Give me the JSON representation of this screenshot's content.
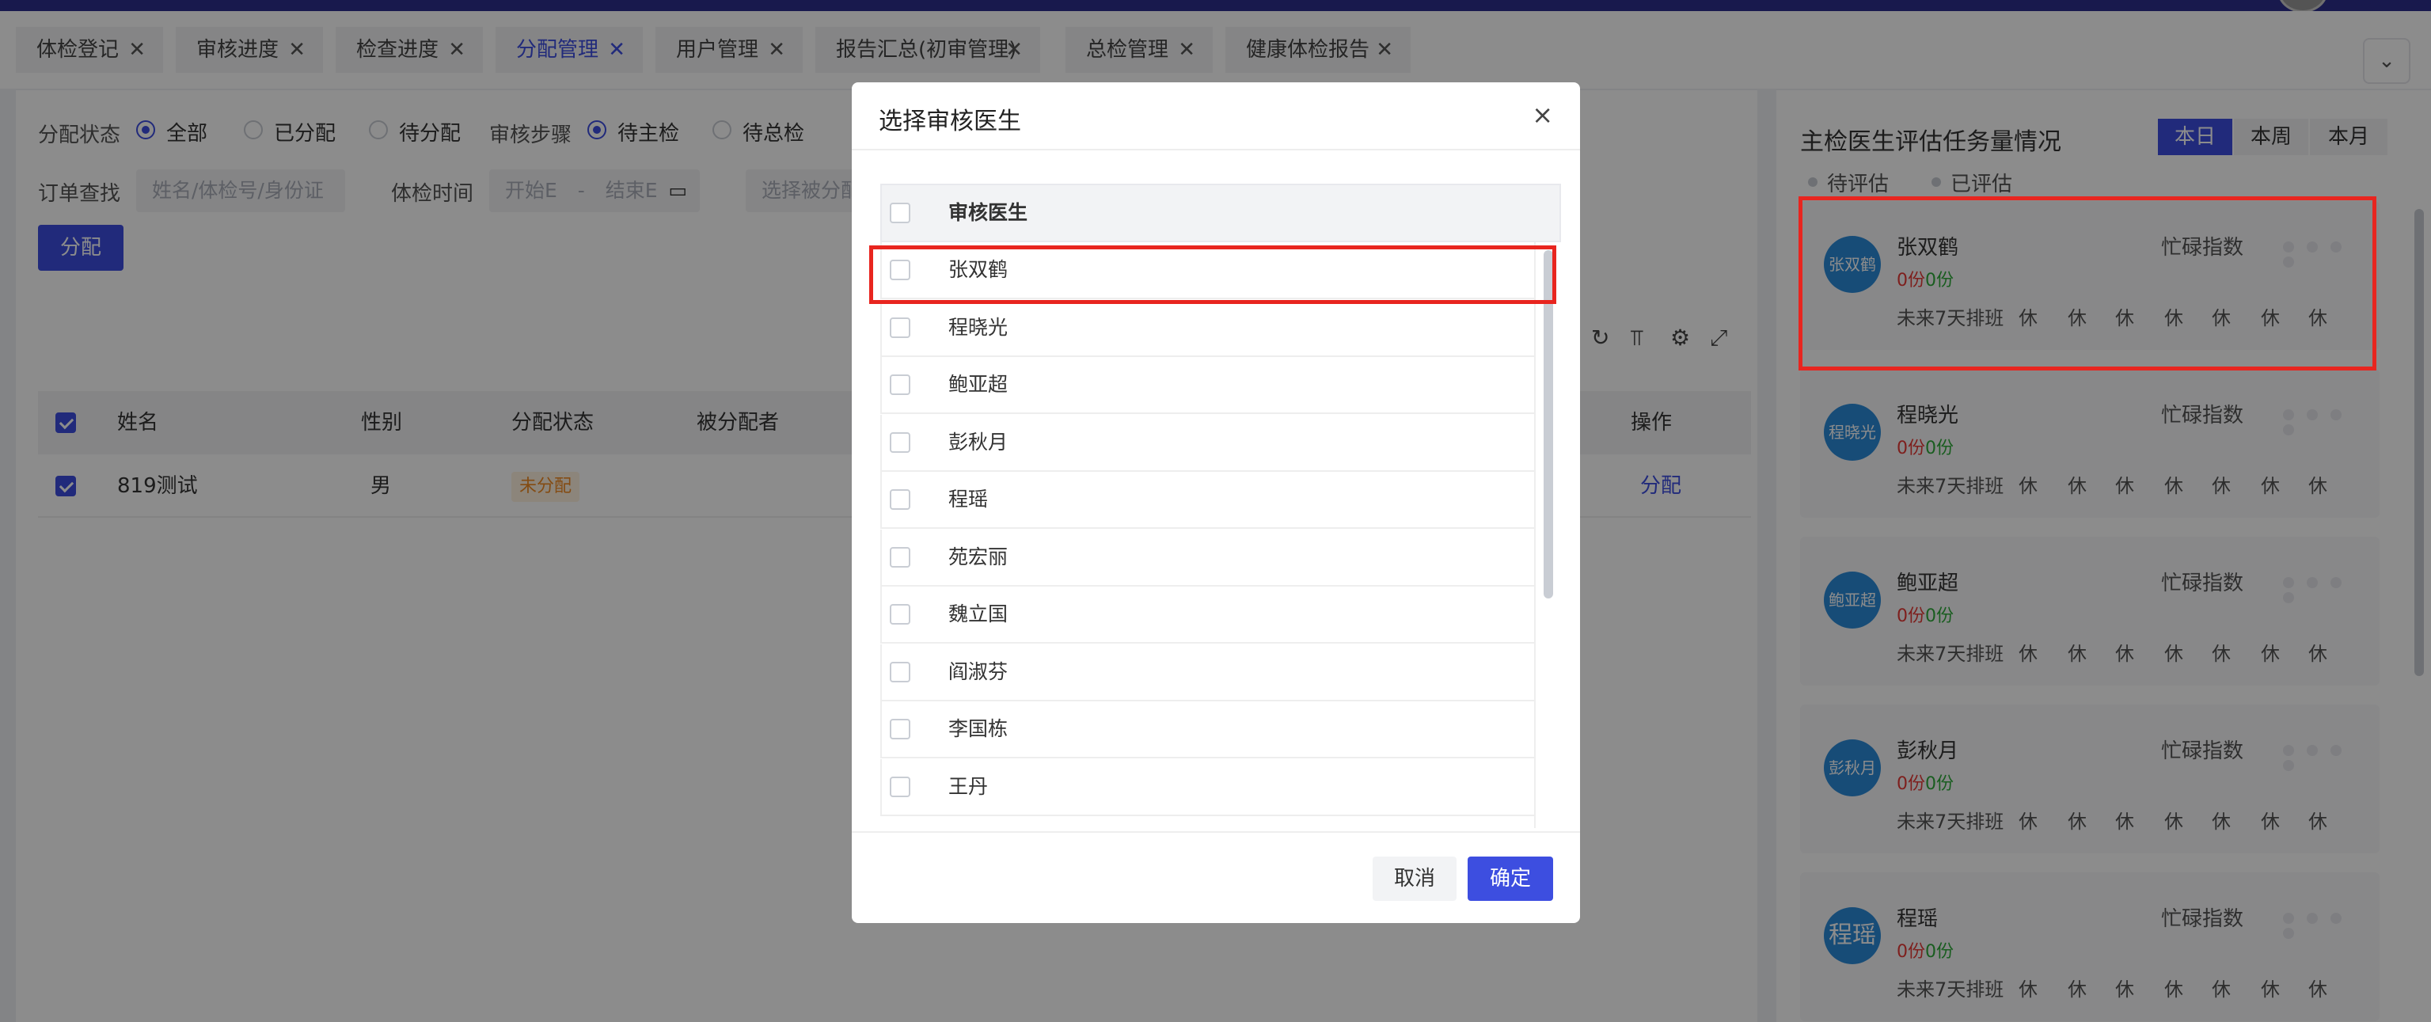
{
  "tabs": [
    {
      "label": "体检登记",
      "active": false
    },
    {
      "label": "审核进度",
      "active": false
    },
    {
      "label": "检查进度",
      "active": false
    },
    {
      "label": "分配管理",
      "active": true
    },
    {
      "label": "用户管理",
      "active": false
    },
    {
      "label": "报告汇总(初审管理)",
      "active": false
    },
    {
      "label": "总检管理",
      "active": false
    },
    {
      "label": "健康体检报告",
      "active": false
    }
  ],
  "tab_close_glyph": "✕",
  "tab_dropdown_glyph": "⌄",
  "filters": {
    "status_label": "分配状态",
    "status_options": [
      "全部",
      "已分配",
      "待分配"
    ],
    "status_selected": "全部",
    "step_label": "审核步骤",
    "step_options": [
      "待主检",
      "待总检"
    ],
    "step_selected": "待主检",
    "order_label": "订单查找",
    "order_placeholder": "姓名/体检号/身份证",
    "date_label": "体检时间",
    "date_start": "开始E",
    "date_sep": "-",
    "date_end": "结束E",
    "assignee_placeholder": "选择被分配",
    "assign_button": "分配"
  },
  "table": {
    "headers": [
      "姓名",
      "性别",
      "分配状态",
      "被分配者",
      "操作"
    ],
    "rows": [
      {
        "name": "819测试",
        "gender": "男",
        "status": "未分配",
        "assignee": "",
        "action": "分配",
        "checked": true
      }
    ]
  },
  "right_panel": {
    "title": "主检医生评估任务量情况",
    "periods": [
      "本日",
      "本周",
      "本月"
    ],
    "period_selected": "本日",
    "legend": [
      "待评估",
      "已评估"
    ],
    "busy_label": "忙碌指数",
    "schedule_label": "未来7天排班",
    "rest_label": "休",
    "count_unit": "份",
    "doctors": [
      {
        "name": "张双鹤",
        "avatar": "张双鹤",
        "pending": "0",
        "done": "0"
      },
      {
        "name": "程晓光",
        "avatar": "程晓光",
        "pending": "0",
        "done": "0"
      },
      {
        "name": "鲍亚超",
        "avatar": "鲍亚超",
        "pending": "0",
        "done": "0"
      },
      {
        "name": "彭秋月",
        "avatar": "彭秋月",
        "pending": "0",
        "done": "0"
      },
      {
        "name": "程瑶",
        "avatar": "程瑶",
        "pending": "0",
        "done": "0"
      }
    ]
  },
  "modal": {
    "title": "选择审核医生",
    "column_header": "审核医生",
    "doctors": [
      "张双鹤",
      "程晓光",
      "鲍亚超",
      "彭秋月",
      "程瑶",
      "苑宏丽",
      "魏立国",
      "阎淑芬",
      "李国栋",
      "王丹"
    ],
    "cancel": "取消",
    "confirm": "确定",
    "close_glyph": "×"
  },
  "colors": {
    "accent": "#3d4ee0",
    "highlight": "#e8251f",
    "pending_count": "#e53935",
    "done_count": "#2eaa3a",
    "avatar": "#2b8ad9"
  }
}
